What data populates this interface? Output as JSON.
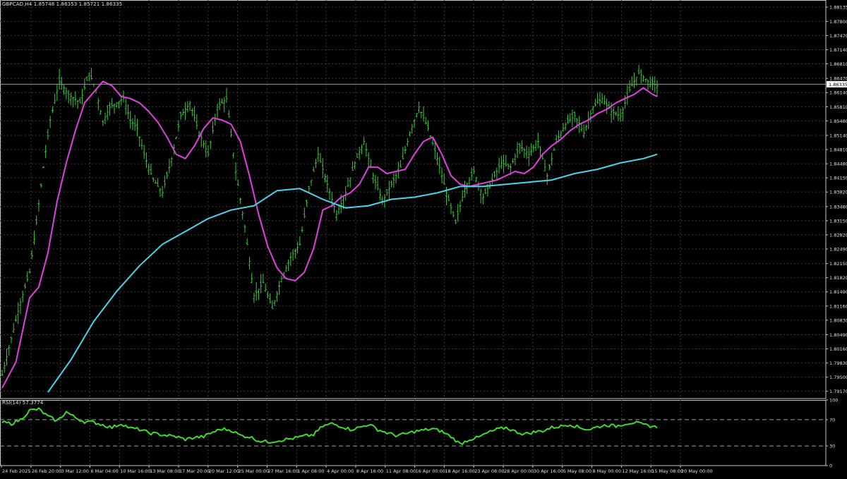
{
  "symbol_label": "GBPCAD,H4",
  "ohlc_label": "1.85748 1.86353 1.85721 1.86335",
  "current_price": "1.86335",
  "colors": {
    "background": "#000000",
    "grid": "#3a3a3a",
    "frame": "#c8c8c8",
    "text": "#e0e0e0",
    "candle": "#39c83c",
    "ma_fast": "#e040e0",
    "ma_slow": "#46d6e6",
    "rsi_line": "#3ddc28",
    "rsi_level": "#a0a0a0"
  },
  "chart_data": [
    {
      "type": "line",
      "title": "GBPCAD,H4",
      "x_tick_labels": [
        "24 Feb 2025",
        "26 Feb 20:00",
        "3 Mar 12:00",
        "6 Mar 04:00",
        "10 Mar 16:00",
        "13 Mar 08:00",
        "17 Mar 20:00",
        "20 Mar 12:00",
        "25 Mar 00:00",
        "27 Mar 16:00",
        "1 Apr 08:00",
        "4 Apr 00:00",
        "8 Apr 16:00",
        "11 Apr 08:00",
        "16 Apr 00:00",
        "18 Apr 16:00",
        "23 Apr 08:00",
        "28 Apr 00:00",
        "30 Apr 16:00",
        "5 May 08:00",
        "8 May 00:00",
        "12 May 16:00",
        "15 May 08:00",
        "20 May 00:00"
      ],
      "y_tick_labels": [
        "1.88135",
        "1.87800",
        "1.87470",
        "1.87140",
        "1.86810",
        "1.86470",
        "1.86140",
        "1.85810",
        "1.85480",
        "1.85140",
        "1.84810",
        "1.84480",
        "1.84150",
        "1.83820",
        "1.83480",
        "1.83150",
        "1.82820",
        "1.82490",
        "1.82150",
        "1.81820",
        "1.81490",
        "1.81160",
        "1.80830",
        "1.80490",
        "1.80160",
        "1.79830",
        "1.79500",
        "1.79170"
      ],
      "ylim": [
        1.79,
        1.883
      ],
      "grid": true,
      "price_path": {
        "x_index": [
          0,
          4,
          8,
          12,
          15,
          18,
          21,
          25,
          29,
          34,
          38,
          41,
          44,
          47,
          50,
          53,
          56,
          59,
          62,
          66,
          70,
          74,
          78,
          82,
          86,
          90,
          94,
          98,
          102,
          106,
          110,
          114,
          118,
          122,
          126,
          130,
          134,
          138,
          142,
          146,
          150,
          154,
          158,
          162,
          166,
          170,
          174,
          178,
          182,
          186,
          190,
          194,
          198,
          202,
          206,
          210,
          214,
          218,
          222,
          226,
          230,
          234,
          238,
          242,
          246,
          250,
          254,
          258,
          262,
          266,
          270,
          274,
          278,
          282,
          286
        ],
        "values": [
          1.7955,
          1.804,
          1.8125,
          1.8195,
          1.831,
          1.844,
          1.855,
          1.864,
          1.861,
          1.859,
          1.866,
          1.862,
          1.8545,
          1.858,
          1.859,
          1.86,
          1.855,
          1.853,
          1.847,
          1.841,
          1.838,
          1.846,
          1.856,
          1.859,
          1.852,
          1.847,
          1.858,
          1.86,
          1.843,
          1.83,
          1.814,
          1.817,
          1.811,
          1.818,
          1.823,
          1.826,
          1.839,
          1.847,
          1.84,
          1.833,
          1.838,
          1.845,
          1.85,
          1.842,
          1.836,
          1.84,
          1.844,
          1.852,
          1.858,
          1.853,
          1.846,
          1.838,
          1.831,
          1.839,
          1.843,
          1.837,
          1.841,
          1.845,
          1.844,
          1.849,
          1.847,
          1.85,
          1.842,
          1.85,
          1.854,
          1.856,
          1.852,
          1.858,
          1.86,
          1.857,
          1.856,
          1.862,
          1.866,
          1.864,
          1.863
        ]
      },
      "series": [
        {
          "kind": "moving_average_fast",
          "x_index": [
            0,
            6,
            12,
            16,
            20,
            24,
            28,
            32,
            36,
            40,
            44,
            48,
            52,
            56,
            60,
            64,
            68,
            72,
            76,
            80,
            84,
            88,
            92,
            96,
            100,
            104,
            108,
            112,
            116,
            120,
            124,
            128,
            132,
            136,
            140,
            144,
            148,
            152,
            156,
            160,
            164,
            168,
            172,
            176,
            180,
            184,
            188,
            192,
            196,
            200,
            204,
            208,
            212,
            216,
            220,
            224,
            228,
            232,
            236,
            240,
            244,
            248,
            252,
            256,
            260,
            264,
            268,
            272,
            276,
            280,
            284,
            286
          ],
          "values": [
            1.7925,
            1.7985,
            1.8135,
            1.816,
            1.824,
            1.836,
            1.845,
            1.8525,
            1.859,
            1.8615,
            1.864,
            1.863,
            1.8605,
            1.86,
            1.859,
            1.857,
            1.8545,
            1.851,
            1.847,
            1.846,
            1.849,
            1.853,
            1.8555,
            1.855,
            1.854,
            1.85,
            1.842,
            1.833,
            1.8255,
            1.8205,
            1.818,
            1.8175,
            1.8195,
            1.825,
            1.834,
            1.835,
            1.837,
            1.838,
            1.84,
            1.844,
            1.844,
            1.8425,
            1.843,
            1.8435,
            1.847,
            1.85,
            1.851,
            1.847,
            1.842,
            1.84,
            1.8395,
            1.84,
            1.8405,
            1.841,
            1.842,
            1.843,
            1.8425,
            1.844,
            1.847,
            1.849,
            1.8505,
            1.8525,
            1.854,
            1.855,
            1.8565,
            1.8575,
            1.859,
            1.86,
            1.861,
            1.8625,
            1.861,
            1.8605
          ]
        },
        {
          "kind": "moving_average_slow",
          "x_index": [
            20,
            30,
            40,
            50,
            60,
            70,
            80,
            90,
            100,
            110,
            120,
            130,
            140,
            150,
            160,
            170,
            180,
            190,
            200,
            210,
            220,
            230,
            240,
            250,
            260,
            270,
            280,
            286
          ],
          "values": [
            1.7915,
            1.799,
            1.808,
            1.815,
            1.821,
            1.826,
            1.829,
            1.832,
            1.834,
            1.835,
            1.8385,
            1.839,
            1.8365,
            1.8345,
            1.835,
            1.8365,
            1.837,
            1.838,
            1.8395,
            1.8395,
            1.84,
            1.8405,
            1.841,
            1.8425,
            1.8435,
            1.845,
            1.846,
            1.847
          ]
        }
      ]
    },
    {
      "type": "line",
      "title": "RSI(14) 57.3774",
      "y_tick_labels": [
        "100",
        "70",
        "30",
        "0"
      ],
      "ylim": [
        0,
        100
      ],
      "levels": [
        70,
        30
      ],
      "series": [
        {
          "name": "RSI(14)",
          "x_index": [
            0,
            4,
            8,
            12,
            16,
            20,
            24,
            28,
            32,
            36,
            40,
            44,
            48,
            52,
            56,
            60,
            64,
            68,
            72,
            76,
            80,
            84,
            88,
            92,
            96,
            100,
            104,
            108,
            112,
            116,
            120,
            124,
            128,
            132,
            136,
            140,
            144,
            148,
            152,
            156,
            160,
            164,
            168,
            172,
            176,
            180,
            184,
            188,
            192,
            196,
            200,
            204,
            208,
            212,
            216,
            220,
            224,
            228,
            232,
            236,
            240,
            244,
            248,
            252,
            256,
            260,
            264,
            268,
            272,
            276,
            280,
            284,
            286
          ],
          "values": [
            66,
            64,
            70,
            84,
            86,
            75,
            68,
            82,
            73,
            67,
            66,
            62,
            58,
            64,
            57,
            55,
            50,
            48,
            46,
            44,
            40,
            43,
            44,
            51,
            56,
            54,
            46,
            44,
            38,
            36,
            38,
            40,
            42,
            45,
            47,
            60,
            64,
            60,
            55,
            58,
            63,
            55,
            50,
            46,
            48,
            52,
            54,
            56,
            52,
            44,
            33,
            40,
            43,
            50,
            55,
            58,
            52,
            48,
            51,
            53,
            58,
            60,
            63,
            58,
            55,
            59,
            62,
            60,
            64,
            66,
            62,
            60,
            57.3774
          ]
        }
      ]
    }
  ]
}
